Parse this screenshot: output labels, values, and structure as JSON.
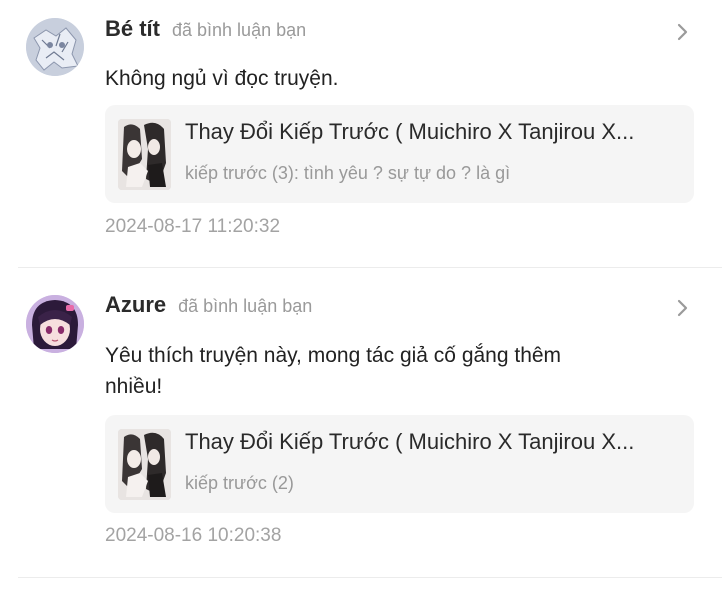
{
  "comments": [
    {
      "username": "Bé tít",
      "action": "đã bình luận bạn",
      "text": "Không ngủ vì đọc truyện.",
      "story": {
        "title": "Thay Đổi Kiếp Trước ( Muichiro X Tanjirou X...",
        "chapter": "kiếp trước (3): tình yêu ? sự tự do ? là gì"
      },
      "timestamp": "2024-08-17 11:20:32"
    },
    {
      "username": "Azure",
      "action": "đã bình luận bạn",
      "text": "Yêu thích truyện này, mong tác giả cố gắng thêm nhiều!",
      "story": {
        "title": "Thay Đổi Kiếp Trước ( Muichiro X Tanjirou X...",
        "chapter": "kiếp trước (2)"
      },
      "timestamp": "2024-08-16 10:20:38"
    }
  ],
  "icons": {
    "chevron": "chevron-right-icon",
    "avatar1": "avatar-sketch",
    "avatar2": "avatar-anime"
  },
  "colors": {
    "muted_text": "#9a9a9a",
    "card_bg": "#f5f5f5",
    "divider": "#ececec"
  }
}
